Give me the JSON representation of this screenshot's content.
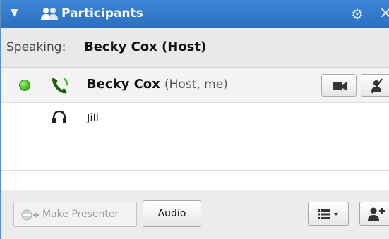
{
  "header": {
    "title": "Participants",
    "icons": [
      "collapse-arrow-icon",
      "people-icon",
      "gear-icon",
      "close-icon"
    ]
  },
  "speaking": {
    "label": "Speaking:",
    "name": "Becky Cox (Host)"
  },
  "participants": [
    {
      "name": "Becky Cox",
      "role": "(Host, me)",
      "status": "active",
      "icons": [
        "status-dot-icon",
        "phone-icon",
        "video-camera-icon",
        "mute-icon"
      ]
    },
    {
      "name": "Jill",
      "role": "",
      "icons": [
        "headset-icon"
      ]
    }
  ],
  "toolbar": {
    "make_presenter_label": "Make Presenter",
    "audio_label": "Audio",
    "icons": [
      "list-menu-icon",
      "add-participant-icon"
    ]
  },
  "colors": {
    "titlebar": "#2a6fc0",
    "status_green": "#3cb318",
    "phone_green": "#2f7d1a"
  }
}
